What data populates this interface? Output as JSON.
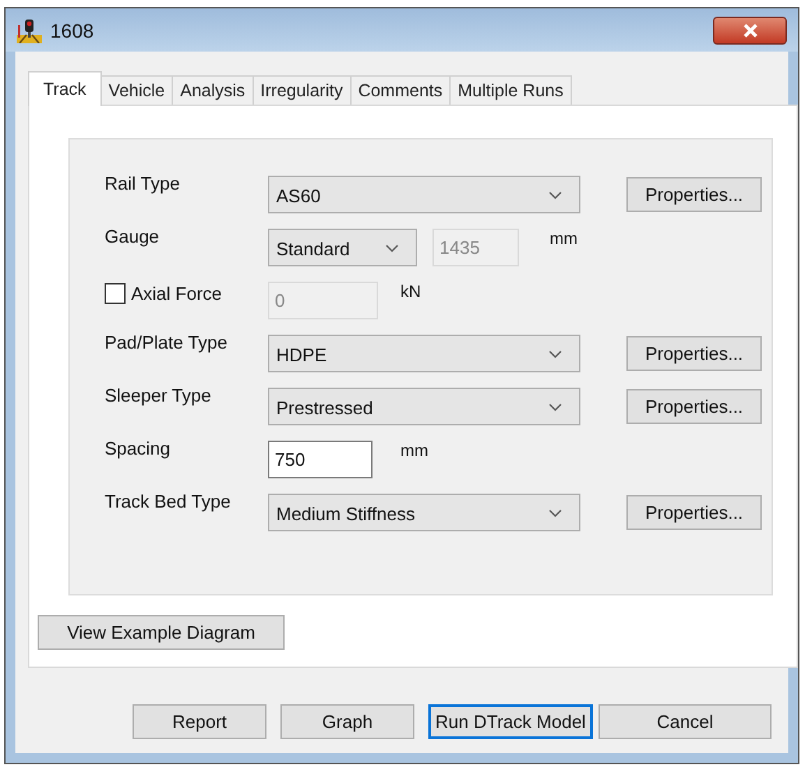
{
  "window": {
    "title": "1608"
  },
  "tabs": [
    {
      "label": "Track",
      "selected": true
    },
    {
      "label": "Vehicle",
      "selected": false
    },
    {
      "label": "Analysis",
      "selected": false
    },
    {
      "label": "Irregularity",
      "selected": false
    },
    {
      "label": "Comments",
      "selected": false
    },
    {
      "label": "Multiple Runs",
      "selected": false
    }
  ],
  "rows": [
    {
      "kind": "combo",
      "label": "Rail Type",
      "value": "AS60",
      "button": "Properties..."
    },
    {
      "kind": "combo_field",
      "label": "Gauge",
      "value": "Standard",
      "field_value": "1435",
      "disabled": true,
      "unit": "mm"
    },
    {
      "kind": "check_field",
      "label": "Axial Force",
      "checked": false,
      "field_value": "0",
      "disabled": true,
      "unit": "kN"
    },
    {
      "kind": "combo",
      "label": "Pad/Plate Type",
      "value": "HDPE",
      "button": "Properties..."
    },
    {
      "kind": "combo",
      "label": "Sleeper Type",
      "value": "Prestressed",
      "button": "Properties..."
    },
    {
      "kind": "field",
      "label": "Spacing",
      "field_value": "750",
      "disabled": false,
      "unit": "mm"
    },
    {
      "kind": "combo",
      "label": "Track Bed Type",
      "value": "Medium Stiffness",
      "button": "Properties..."
    }
  ],
  "diagram_button": "View Example Diagram",
  "buttons": [
    {
      "label": "Report",
      "default": false
    },
    {
      "label": "Graph",
      "default": false
    },
    {
      "label": "Run DTrack Model",
      "default": true
    },
    {
      "label": "Cancel",
      "default": false
    }
  ]
}
